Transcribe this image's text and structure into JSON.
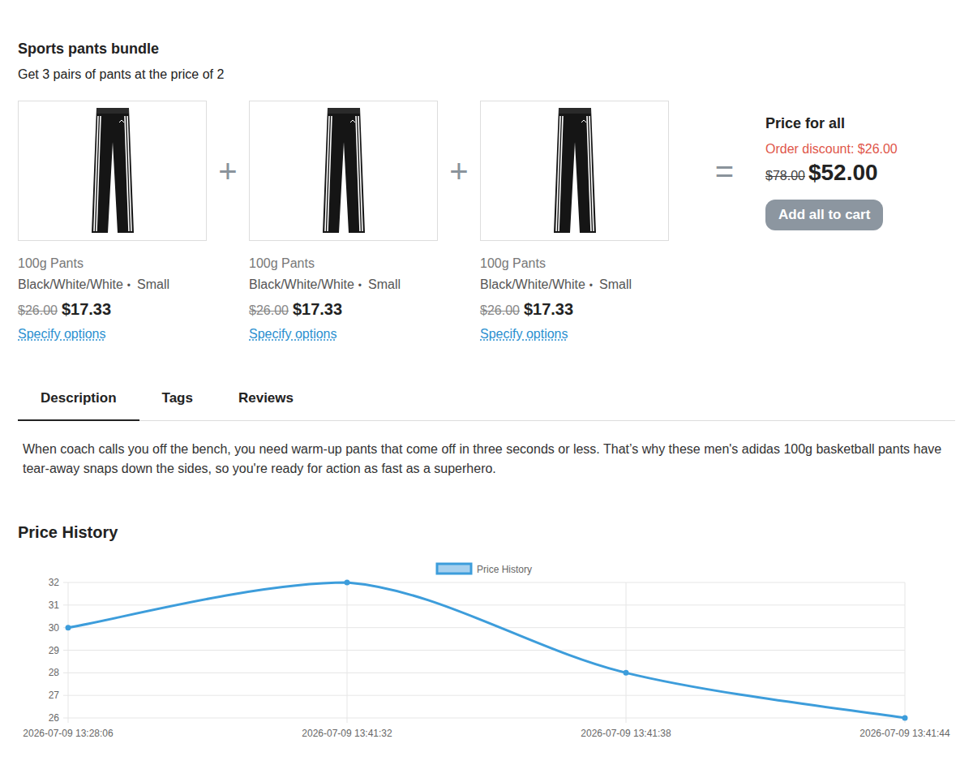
{
  "bundle": {
    "title": "Sports pants bundle",
    "subtitle": "Get 3 pairs of pants at the price of 2"
  },
  "products": [
    {
      "name": "100g Pants",
      "variant": "Black/White/White",
      "bullet": "•",
      "size": "Small",
      "old_price": "$26.00",
      "price": "$17.33",
      "link": "Specify options"
    },
    {
      "name": "100g Pants",
      "variant": "Black/White/White",
      "bullet": "•",
      "size": "Small",
      "old_price": "$26.00",
      "price": "$17.33",
      "link": "Specify options"
    },
    {
      "name": "100g Pants",
      "variant": "Black/White/White",
      "bullet": "•",
      "size": "Small",
      "old_price": "$26.00",
      "price": "$17.33",
      "link": "Specify options"
    }
  ],
  "operators": [
    "+",
    "+",
    "="
  ],
  "summary": {
    "title": "Price for all",
    "discount": "Order discount: $26.00",
    "old_total": "$78.00",
    "total": "$52.00",
    "button": "Add all to cart",
    "button_disabled": true
  },
  "tabs": [
    {
      "label": "Description",
      "selected": true
    },
    {
      "label": "Tags",
      "selected": false
    },
    {
      "label": "Reviews",
      "selected": false
    }
  ],
  "description": "When coach calls you off the bench, you need warm-up pants that come off in three seconds or less. That’s why these men's adidas 100g basketball pants have tear-away snaps down the sides, so you're ready for action as fast as a superhero.",
  "chart": {
    "title": "Price History",
    "legend": "Price History",
    "y_ticks": [
      "26",
      "27",
      "28",
      "29",
      "30",
      "31",
      "32"
    ],
    "x_labels": [
      "2026-07-09 13:28:06",
      "2026-07-09 13:41:32",
      "2026-07-09 13:41:38",
      "2026-07-09 13:41:44"
    ],
    "series": [
      {
        "values": [
          30,
          32,
          28,
          26
        ]
      }
    ]
  }
}
